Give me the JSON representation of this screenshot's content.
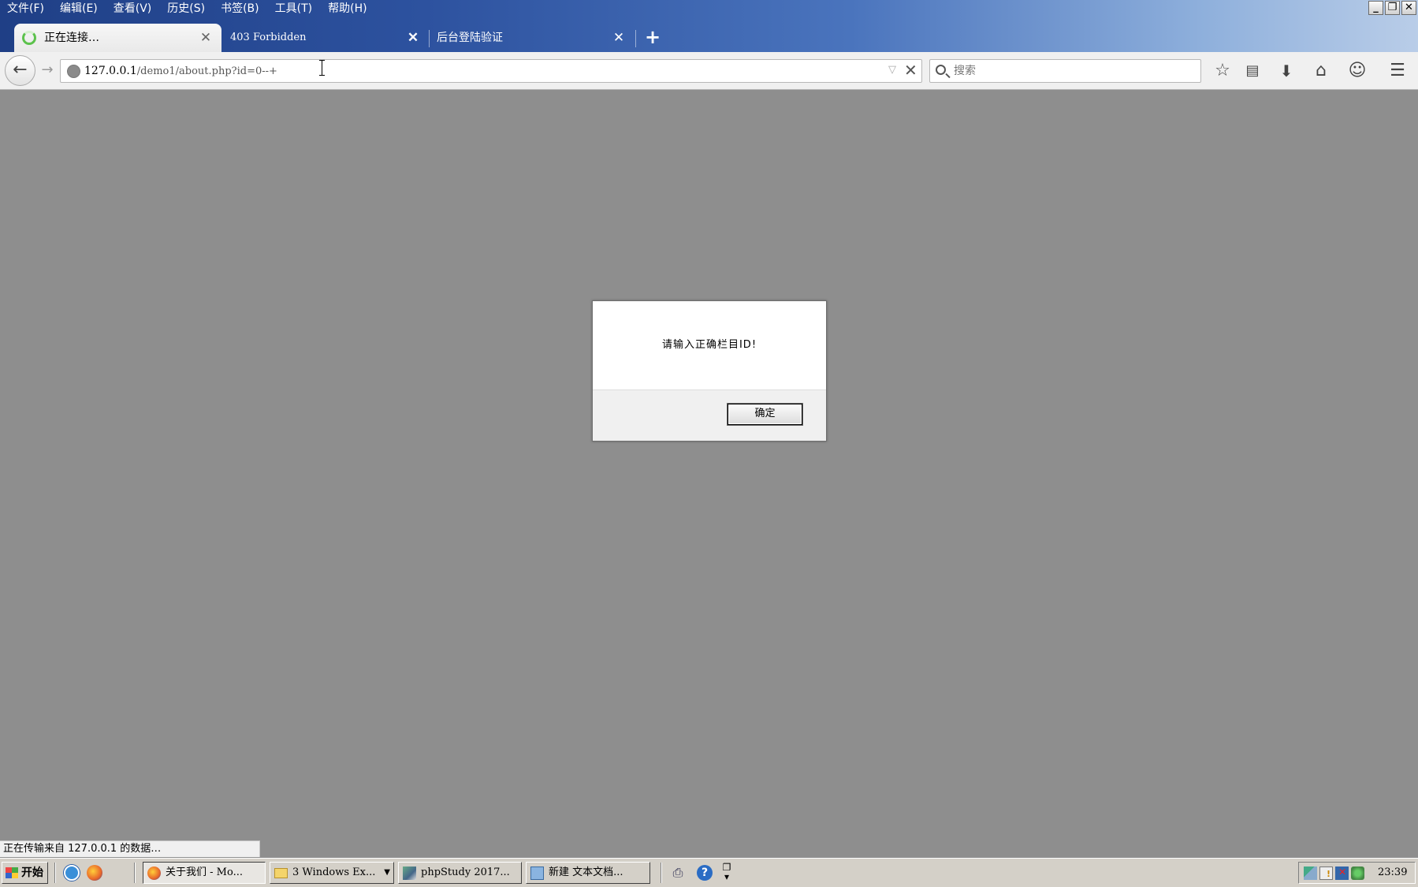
{
  "menubar": {
    "items": [
      "文件(F)",
      "编辑(E)",
      "查看(V)",
      "历史(S)",
      "书签(B)",
      "工具(T)",
      "帮助(H)"
    ]
  },
  "window_controls": {
    "minimize": "_",
    "restore": "❐",
    "close": "✕"
  },
  "tabs": [
    {
      "title": "正在连接…",
      "state": "loading",
      "active": true
    },
    {
      "title": "403 Forbidden",
      "active": false
    },
    {
      "title": "后台登陆验证",
      "active": false
    }
  ],
  "new_tab_label": "+",
  "navbar": {
    "url_host": "127.0.0.1",
    "url_path": "/demo1/about.php?id=0--+",
    "search_placeholder": "搜索"
  },
  "alert": {
    "message": "请输入正确栏目ID!",
    "ok_label": "确定"
  },
  "status_bar": {
    "text": "正在传输来自 127.0.0.1 的数据…"
  },
  "taskbar": {
    "start_label": "开始",
    "tasks": [
      {
        "label": "关于我们 - Mo...",
        "active": true
      },
      {
        "label": "3 Windows Ex...",
        "active": false
      },
      {
        "label": "phpStudy 2017...",
        "active": false
      },
      {
        "label": "新建 文本文档...",
        "active": false
      }
    ],
    "clock": "23:39"
  },
  "colors": {
    "titlebar_start": "#1f3f86",
    "titlebar_end": "#b9cde8",
    "content_bg": "#8e8e8e",
    "loading_spinner": "#5cc24c"
  }
}
